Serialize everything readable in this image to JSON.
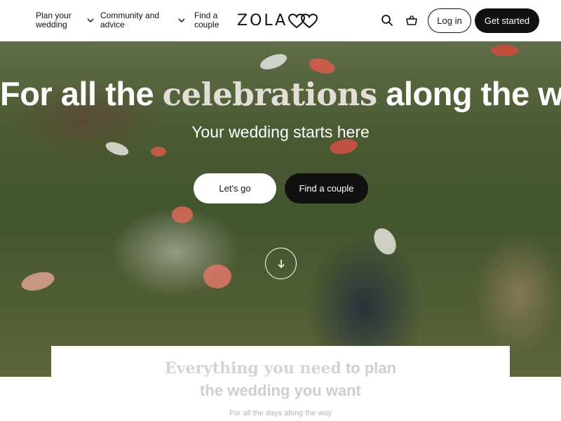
{
  "header": {
    "nav": {
      "plan": "Plan your wedding",
      "community": "Community and advice",
      "find_couple": "Find a couple"
    },
    "logo_text": "ZOLA",
    "search_icon": "search-icon",
    "cart_icon": "cart-icon",
    "login_label": "Log in",
    "get_started_label": "Get started"
  },
  "hero": {
    "title_before": "For all the",
    "title_accent": "celebrations",
    "title_after": "along the way",
    "subtitle": "Your wedding starts here",
    "primary_button": "Let's go",
    "secondary_button": "Find a couple",
    "scroll_icon": "arrow-down-icon"
  },
  "card": {
    "heading_serif": "Everything you need",
    "heading_rest_1": "to plan",
    "heading_line_2": "the wedding you want",
    "subheading": "For all the days along the way"
  },
  "colors": {
    "brand_dark": "#111111",
    "header_bg": "#ffffff",
    "hero_accent": "#e2ddd6"
  }
}
